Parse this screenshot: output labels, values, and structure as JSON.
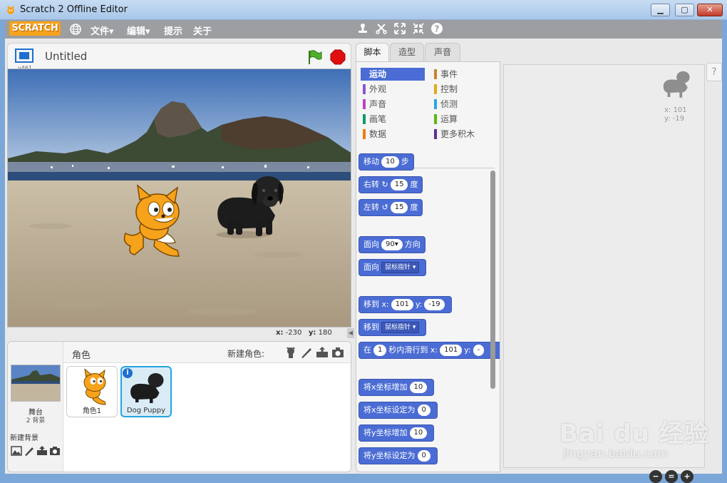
{
  "window": {
    "title": "Scratch 2 Offline Editor",
    "min_glyph": "▁",
    "max_glyph": "▢",
    "close_glyph": "✕"
  },
  "menubar": {
    "logo": "SCRATCH",
    "items": [
      "文件▾",
      "编辑▾",
      "提示",
      "关于"
    ]
  },
  "stage": {
    "version": "v461",
    "project_title": "Untitled",
    "mouse_x_label": "x:",
    "mouse_x": "-230",
    "mouse_y_label": "y:",
    "mouse_y": "180"
  },
  "sprites": {
    "label": "角色",
    "new_sprite_label": "新建角色:",
    "stage_label": "舞台",
    "backdrop_count": "2 背景",
    "new_backdrop_label": "新建背景",
    "list": [
      {
        "name": "角色1"
      },
      {
        "name": "Dog Puppy",
        "selected": true
      }
    ]
  },
  "tabs": [
    "脚本",
    "造型",
    "声音"
  ],
  "categories": [
    {
      "label": "运动",
      "color": "#4a6cd4",
      "active": true
    },
    {
      "label": "事件",
      "color": "#c88330"
    },
    {
      "label": "外观",
      "color": "#8a55d7"
    },
    {
      "label": "控制",
      "color": "#e1a91a"
    },
    {
      "label": "声音",
      "color": "#bb42c3"
    },
    {
      "label": "侦测",
      "color": "#2ca5e2"
    },
    {
      "label": "画笔",
      "color": "#0e9a6c"
    },
    {
      "label": "运算",
      "color": "#5cb712"
    },
    {
      "label": "数据",
      "color": "#ee7d16"
    },
    {
      "label": "更多积木",
      "color": "#632d99"
    }
  ],
  "blocks": {
    "move": {
      "a": "移动",
      "n": "10",
      "b": "步"
    },
    "turn_right": {
      "a": "右转",
      "n": "15",
      "b": "度"
    },
    "turn_left": {
      "a": "左转",
      "n": "15",
      "b": "度"
    },
    "point_dir": {
      "a": "面向",
      "n": "90▾",
      "b": "方向"
    },
    "point_towards": {
      "a": "面向",
      "dd": "鼠标指针 ▾"
    },
    "goto_xy": {
      "a": "移到 x:",
      "x": "101",
      "y_label": "y:",
      "y": "-19"
    },
    "goto": {
      "a": "移到",
      "dd": "鼠标指针 ▾"
    },
    "glide": {
      "a": "在",
      "n": "1",
      "b": "秒内滑行到 x:",
      "x": "101",
      "y_label": "y:",
      "y": "-"
    },
    "change_x": {
      "a": "将x坐标增加",
      "n": "10"
    },
    "set_x": {
      "a": "将x坐标设定为",
      "n": "0"
    },
    "change_y": {
      "a": "将y坐标增加",
      "n": "10"
    },
    "set_y": {
      "a": "将y坐标设定为",
      "n": "0"
    }
  },
  "script_area": {
    "sprite_x": "x: 101",
    "sprite_y": "y: -19",
    "help": "?",
    "zoom_out": "−",
    "zoom_reset": "=",
    "zoom_in": "+"
  },
  "watermark": {
    "text": "Bai du 经验",
    "sub": "jingyan.baidu.com"
  }
}
